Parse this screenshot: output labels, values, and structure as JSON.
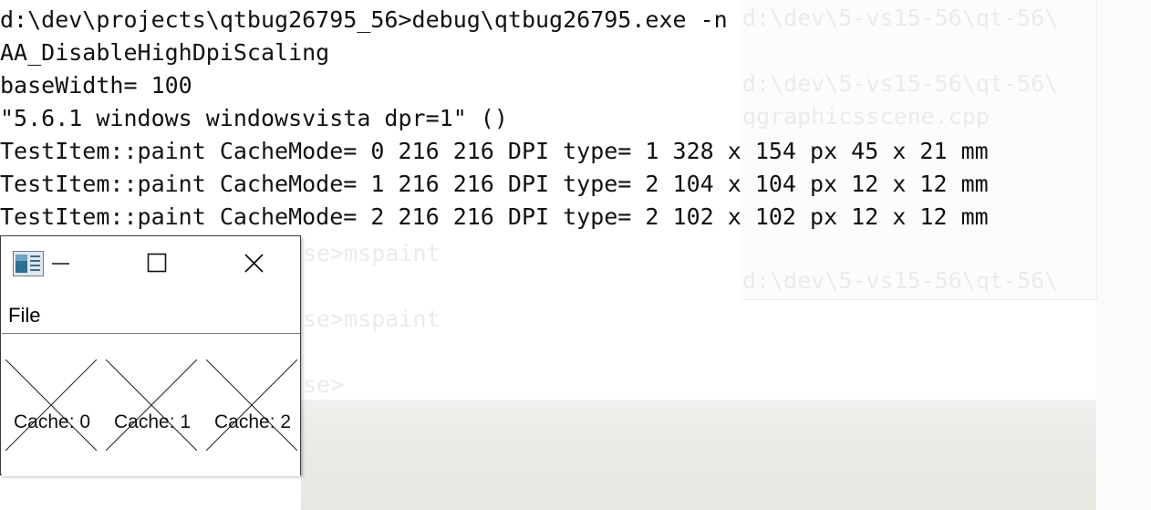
{
  "console": {
    "lines": [
      "d:\\dev\\projects\\qtbug26795_56>debug\\qtbug26795.exe -n",
      "AA_DisableHighDpiScaling",
      "baseWidth= 100",
      "\"5.6.1 windows windowsvista dpr=1\" ()",
      "TestItem::paint CacheMode= 0 216 216 DPI type= 1 328 x 154 px 45 x 21 mm",
      "TestItem::paint CacheMode= 1 216 216 DPI type= 2 104 x 104 px 12 x 12 mm",
      "TestItem::paint CacheMode= 2 216 216 DPI type= 2 102 x 102 px 12 x 12 mm"
    ]
  },
  "background": {
    "ghost_lines": [
      "d:\\dev\\5-vs15-56\\qt-56\\",
      "d:\\dev\\5-vs15-56\\qt-56\\",
      "qgraphicsscene.cpp",
      "d:\\dev\\5-vs15-56\\qt-56\\",
      "se>mspaint",
      "se>mspaint",
      "se>"
    ]
  },
  "window": {
    "icon": "app-icon",
    "minimize_icon": "minimize-icon",
    "maximize_icon": "maximize-icon",
    "close_icon": "close-icon",
    "menu": [
      "File"
    ],
    "items": [
      {
        "label": "Cache: 0"
      },
      {
        "label": "Cache: 1"
      },
      {
        "label": "Cache: 2"
      }
    ]
  },
  "colors": {
    "text": "#111111",
    "window_border": "#3a3a3a",
    "ghost_text": "#ebebeb"
  }
}
